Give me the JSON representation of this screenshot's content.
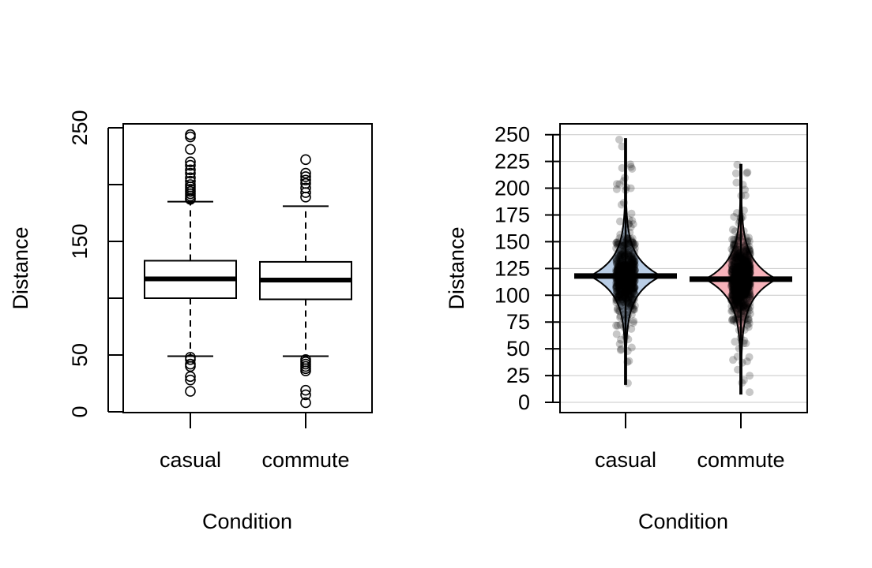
{
  "chart_data": [
    {
      "type": "boxplot",
      "title": "",
      "xlabel": "Condition",
      "ylabel": "Distance",
      "categories": [
        "casual",
        "commute"
      ],
      "ylim": [
        0,
        250
      ],
      "y_ticks": [
        0,
        50,
        100,
        150,
        200,
        250
      ],
      "y_tick_labels": [
        "0",
        "50",
        "",
        "150",
        "",
        "250"
      ],
      "grid": false,
      "series": [
        {
          "name": "casual",
          "q1": 100,
          "median": 117,
          "q3": 133,
          "whisker_low": 49,
          "whisker_high": 185,
          "outliers": [
            244,
            242,
            231,
            220,
            217,
            213,
            210,
            206,
            203,
            200,
            198,
            196,
            194,
            192,
            190,
            188,
            187,
            48,
            46,
            42,
            40,
            31,
            28,
            18
          ]
        },
        {
          "name": "commute",
          "q1": 99,
          "median": 116,
          "q3": 132,
          "whisker_low": 49,
          "whisker_high": 181,
          "outliers": [
            222,
            210,
            207,
            204,
            201,
            197,
            193,
            189,
            46,
            44,
            42,
            40,
            38,
            36,
            19,
            15,
            8
          ]
        }
      ]
    },
    {
      "type": "pirateplot",
      "title": "",
      "xlabel": "Condition",
      "ylabel": "Distance",
      "categories": [
        "casual",
        "commute"
      ],
      "ylim": [
        0,
        250
      ],
      "y_ticks": [
        0,
        25,
        50,
        75,
        100,
        125,
        150,
        175,
        200,
        225,
        250
      ],
      "y_tick_labels": [
        "0",
        "25",
        "50",
        "75",
        "100",
        "125",
        "150",
        "175",
        "200",
        "225",
        "250"
      ],
      "grid": true,
      "series": [
        {
          "name": "casual",
          "color": "#b9cde5",
          "mean": 118,
          "min": 17,
          "max": 246,
          "center": 118,
          "spread": 18
        },
        {
          "name": "commute",
          "color": "#f7b3bb",
          "mean": 115,
          "min": 8,
          "max": 222,
          "center": 115,
          "spread": 19
        }
      ]
    }
  ]
}
